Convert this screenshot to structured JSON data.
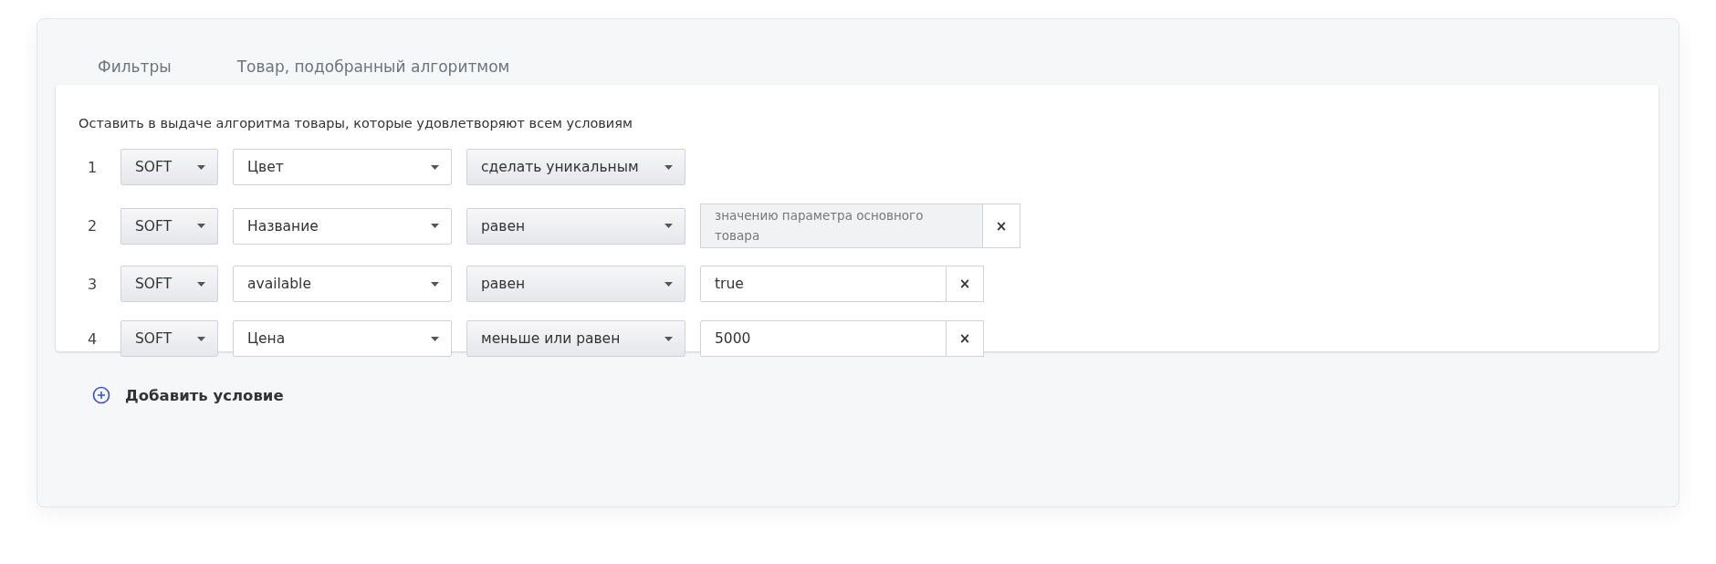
{
  "tabs": [
    {
      "label": "Фильтры"
    },
    {
      "label": "Товар, подобранный алгоритмом"
    }
  ],
  "description": "Оставить в выдаче алгоритма товары, которые удовлетворяют всем условиям",
  "conditions": [
    {
      "number": "1",
      "mode": "SOFT",
      "field": "Цвет",
      "operator": "сделать уникальным"
    },
    {
      "number": "2",
      "mode": "SOFT",
      "field": "Название",
      "operator": "равен",
      "value": {
        "kind": "parameter",
        "text": "значению параметра основного товара",
        "remove": "×"
      }
    },
    {
      "number": "3",
      "mode": "SOFT",
      "field": "available",
      "operator": "равен",
      "value": {
        "kind": "input",
        "text": "true",
        "remove": "×"
      }
    },
    {
      "number": "4",
      "mode": "SOFT",
      "field": "Цена",
      "operator": "меньше или равен",
      "value": {
        "kind": "input",
        "text": "5000",
        "remove": "×"
      }
    }
  ],
  "add_condition": "Добавить условие"
}
